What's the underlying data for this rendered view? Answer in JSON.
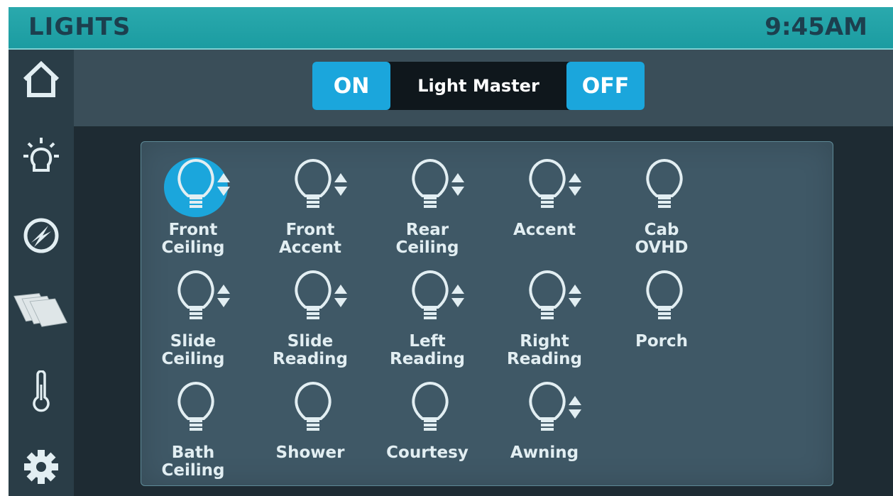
{
  "header": {
    "title": "LIGHTS",
    "time": "9:45AM"
  },
  "sidebar": {
    "items": [
      {
        "name": "home",
        "icon": "home-icon"
      },
      {
        "name": "lights",
        "icon": "bulb-rays-icon"
      },
      {
        "name": "power",
        "icon": "power-bolt-icon"
      },
      {
        "name": "slides",
        "icon": "slide-panels-icon"
      },
      {
        "name": "climate",
        "icon": "thermometer-icon"
      },
      {
        "name": "settings",
        "icon": "gear-icon"
      }
    ]
  },
  "master": {
    "on_label": "ON",
    "label": "Light Master",
    "off_label": "OFF"
  },
  "lights": [
    {
      "label": "Front\nCeiling",
      "dimmable": true,
      "active": true
    },
    {
      "label": "Front\nAccent",
      "dimmable": true,
      "active": false
    },
    {
      "label": "Rear\nCeiling",
      "dimmable": true,
      "active": false
    },
    {
      "label": "Accent",
      "dimmable": true,
      "active": false
    },
    {
      "label": "Cab\nOVHD",
      "dimmable": false,
      "active": false
    },
    {
      "label": "Slide\nCeiling",
      "dimmable": true,
      "active": false
    },
    {
      "label": "Slide\nReading",
      "dimmable": true,
      "active": false
    },
    {
      "label": "Left\nReading",
      "dimmable": true,
      "active": false
    },
    {
      "label": "Right\nReading",
      "dimmable": true,
      "active": false
    },
    {
      "label": "Porch",
      "dimmable": false,
      "active": false
    },
    {
      "label": "Bath\nCeiling",
      "dimmable": false,
      "active": false
    },
    {
      "label": "Shower",
      "dimmable": false,
      "active": false
    },
    {
      "label": "Courtesy",
      "dimmable": false,
      "active": false
    },
    {
      "label": "Awning",
      "dimmable": true,
      "active": false
    }
  ],
  "colors": {
    "header": "#1b9ca1",
    "accent": "#1ba6dc",
    "icon": "#e2eef2"
  }
}
